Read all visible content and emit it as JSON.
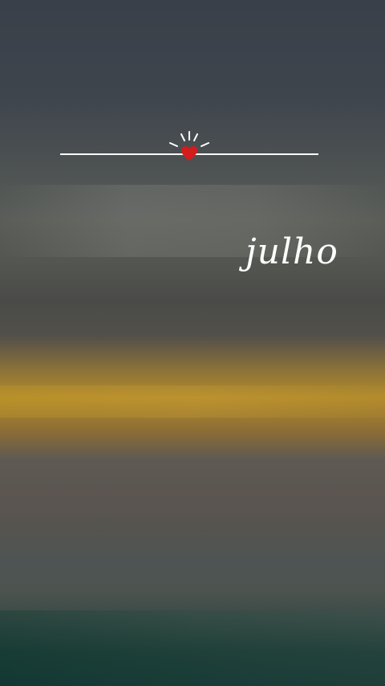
{
  "overlay": {
    "word": "julho",
    "icons": {
      "heart": "heart-icon",
      "rays": "sun-rays-icon"
    },
    "colors": {
      "heart": "#d31c1c",
      "line": "#ffffff",
      "text": "#ffffff"
    }
  }
}
